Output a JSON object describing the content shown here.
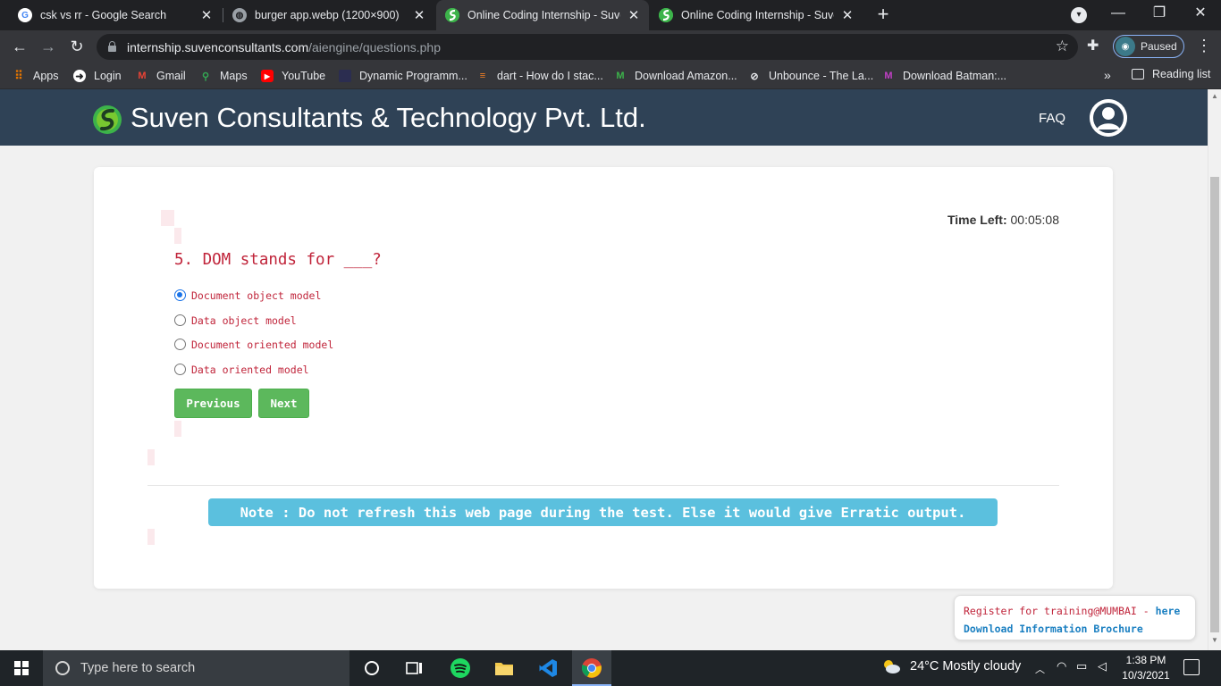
{
  "browser": {
    "tabs": [
      {
        "title": "csk vs rr - Google Search",
        "favicon": "google-icon",
        "active": false
      },
      {
        "title": "burger app.webp (1200×900)",
        "favicon": "globe-icon",
        "active": false
      },
      {
        "title": "Online Coding Internship - Suven",
        "favicon": "suven-logo-icon",
        "active": true
      },
      {
        "title": "Online Coding Internship - Suven",
        "favicon": "suven-logo-icon",
        "active": false
      }
    ],
    "url_domain": "internship.suvenconsultants.com",
    "url_path": "/aiengine/questions.php",
    "profile_status": "Paused",
    "bookmarks": [
      {
        "label": "Apps",
        "icon": "apps-grid-icon"
      },
      {
        "label": "Login",
        "icon": "login-icon"
      },
      {
        "label": "Gmail",
        "icon": "gmail-icon"
      },
      {
        "label": "Maps",
        "icon": "maps-pin-icon"
      },
      {
        "label": "YouTube",
        "icon": "youtube-icon"
      },
      {
        "label": "Dynamic Programm...",
        "icon": "page-icon"
      },
      {
        "label": "dart - How do I stac...",
        "icon": "stackoverflow-icon"
      },
      {
        "label": "Download Amazon...",
        "icon": "m-logo-icon"
      },
      {
        "label": "Unbounce - The La...",
        "icon": "unbounce-icon"
      },
      {
        "label": "Download Batman:...",
        "icon": "m-color-icon"
      }
    ],
    "more_bookmarks": "»",
    "reading_list": "Reading list"
  },
  "site": {
    "title": "Suven Consultants & Technology Pvt. Ltd.",
    "faq": "FAQ"
  },
  "quiz": {
    "time_left_label": "Time Left:",
    "time_left_value": "00:05:08",
    "question": "5. DOM stands for ___?",
    "options": [
      {
        "label": "Document object model",
        "checked": true
      },
      {
        "label": "Data object model",
        "checked": false
      },
      {
        "label": "Document oriented model",
        "checked": false
      },
      {
        "label": "Data oriented model",
        "checked": false
      }
    ],
    "previous_label": "Previous",
    "next_label": "Next",
    "note": "Note : Do not refresh this web page during the test. Else it would give Erratic output."
  },
  "promo": {
    "register_text": "Register for training@MUMBAI - ",
    "here_link": "here",
    "brochure_link": "Download Information Brochure"
  },
  "taskbar": {
    "search_placeholder": "Type here to search",
    "weather": "24°C  Mostly cloudy",
    "time": "1:38 PM",
    "date": "10/3/2021"
  },
  "colors": {
    "header_bg": "#2f4256",
    "accent_red": "#c0243a",
    "button_green": "#5cb85c",
    "note_blue": "#5bc0de"
  }
}
